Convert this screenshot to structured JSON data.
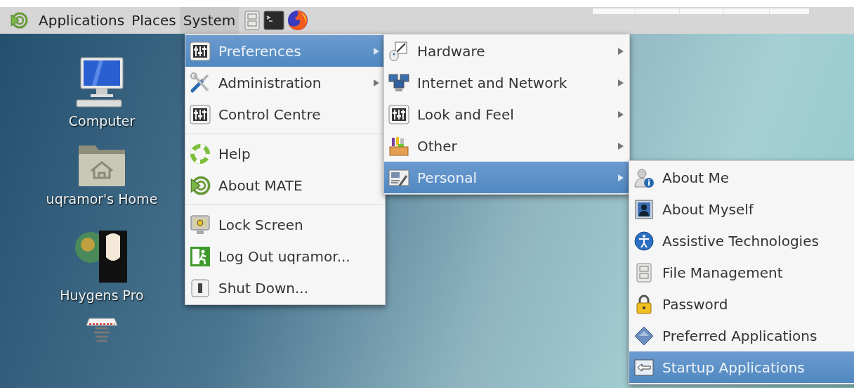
{
  "panel": {
    "menus": [
      {
        "label": "Applications",
        "selected": false
      },
      {
        "label": "Places",
        "selected": false
      },
      {
        "label": "System",
        "selected": true
      }
    ]
  },
  "desktop_icons": [
    {
      "label": "Computer",
      "kind": "computer"
    },
    {
      "label": "uqramor's Home",
      "kind": "home"
    },
    {
      "label": "Huygens Pro",
      "kind": "app"
    },
    {
      "kind": "spring"
    }
  ],
  "system_menu": {
    "groups": [
      [
        {
          "label": "Preferences",
          "selected": true,
          "submenu": true
        },
        {
          "label": "Administration",
          "selected": false,
          "submenu": true
        },
        {
          "label": "Control Centre",
          "selected": false,
          "submenu": false
        }
      ],
      [
        {
          "label": "Help",
          "selected": false,
          "submenu": false
        },
        {
          "label": "About MATE",
          "selected": false,
          "submenu": false
        }
      ],
      [
        {
          "label": "Lock Screen",
          "selected": false,
          "submenu": false
        },
        {
          "label": "Log Out uqramor...",
          "selected": false,
          "submenu": false
        },
        {
          "label": "Shut Down...",
          "selected": false,
          "submenu": false
        }
      ]
    ]
  },
  "preferences_menu": {
    "groups": [
      [
        {
          "label": "Hardware",
          "selected": false,
          "submenu": true
        },
        {
          "label": "Internet and Network",
          "selected": false,
          "submenu": true
        },
        {
          "label": "Look and Feel",
          "selected": false,
          "submenu": true
        },
        {
          "label": "Other",
          "selected": false,
          "submenu": true
        },
        {
          "label": "Personal",
          "selected": true,
          "submenu": true
        }
      ]
    ]
  },
  "personal_menu": {
    "groups": [
      [
        {
          "label": "About Me",
          "selected": false,
          "submenu": false
        },
        {
          "label": "About Myself",
          "selected": false,
          "submenu": false
        },
        {
          "label": "Assistive Technologies",
          "selected": false,
          "submenu": false
        },
        {
          "label": "File Management",
          "selected": false,
          "submenu": false
        },
        {
          "label": "Password",
          "selected": false,
          "submenu": false
        },
        {
          "label": "Preferred Applications",
          "selected": false,
          "submenu": false
        },
        {
          "label": "Startup Applications",
          "selected": true,
          "submenu": false
        }
      ]
    ]
  }
}
